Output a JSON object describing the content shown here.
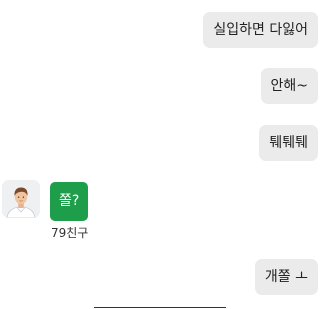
{
  "messages": {
    "outgoing": [
      "실입하면 다잃어",
      "안해~",
      "퉤퉤퉤",
      "개쫄 ㅗ"
    ],
    "incoming": {
      "text": "쫄?",
      "sender": "79친구"
    }
  },
  "colors": {
    "outgoing_bubble": "#ebebeb",
    "incoming_bubble": "#1e9e4a",
    "background": "#ffffff"
  }
}
